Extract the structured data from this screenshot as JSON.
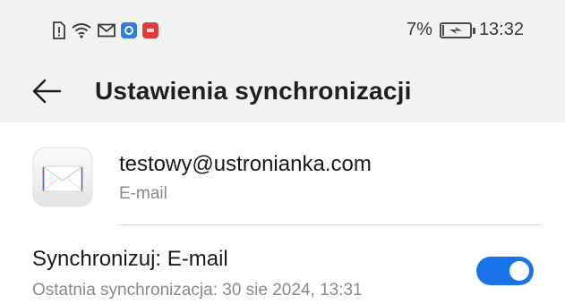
{
  "status_bar": {
    "icons": [
      "sim-missing-icon",
      "wifi-icon",
      "mail-icon",
      "app-blue-icon",
      "app-red-icon"
    ],
    "battery_percent": "7%",
    "battery_level": 0.07,
    "charging": true,
    "time": "13:32"
  },
  "header": {
    "title": "Ustawienia synchronizacji",
    "back_icon": "arrow-left-icon"
  },
  "account": {
    "icon": "envelope-icon",
    "email": "testowy@ustronianka.com",
    "type": "E-mail"
  },
  "sync": {
    "title": "Synchronizuj: E-mail",
    "subtitle": "Ostatnia synchronizacja: 30 sie 2024, 13:31",
    "enabled": true
  },
  "colors": {
    "header_bg": "#f2f2f2",
    "accent": "#1a73e8",
    "secondary_text": "#8a8a8a"
  }
}
